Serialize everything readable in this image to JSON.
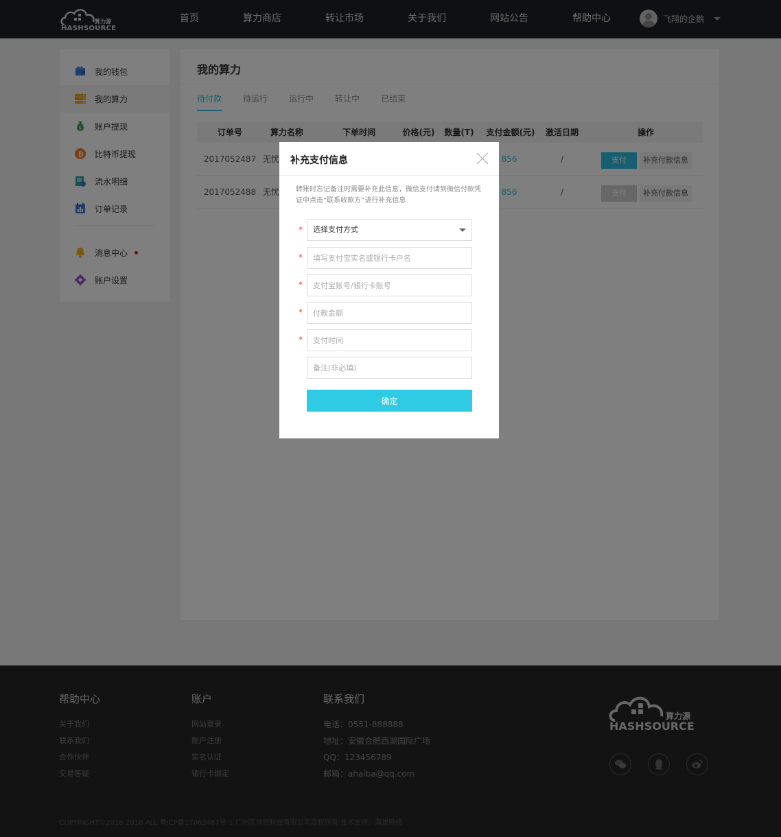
{
  "header": {
    "logo_cn": "算力源",
    "logo_en": "HASHSOURCE",
    "nav": [
      {
        "label": "首页"
      },
      {
        "label": "算力商店"
      },
      {
        "label": "转让市场"
      },
      {
        "label": "关于我们"
      },
      {
        "label": "网站公告"
      },
      {
        "label": "帮助中心"
      }
    ],
    "user_name": "飞翔的企鹅"
  },
  "sidebar": {
    "items": [
      {
        "label": "我的钱包",
        "icon": "wallet-icon",
        "color": "#3b7bd9"
      },
      {
        "label": "我的算力",
        "icon": "server-icon",
        "color": "#f0a21a"
      },
      {
        "label": "账户提现",
        "icon": "money-bag-icon",
        "color": "#3ba34a"
      },
      {
        "label": "比特币提现",
        "icon": "bitcoin-icon",
        "color": "#f07b27"
      },
      {
        "label": "流水明细",
        "icon": "ledger-icon",
        "color": "#26a69a"
      },
      {
        "label": "订单记录",
        "icon": "calendar-chart-icon",
        "color": "#3b7bd9"
      },
      {
        "label": "消息中心",
        "icon": "bell-icon",
        "color": "#f0b21a"
      },
      {
        "label": "账户设置",
        "icon": "gear-icon",
        "color": "#8e4fc9"
      }
    ]
  },
  "main": {
    "title": "我的算力",
    "tabs": [
      {
        "label": "待付款"
      },
      {
        "label": "待运行"
      },
      {
        "label": "运行中"
      },
      {
        "label": "转让中"
      },
      {
        "label": "已结束"
      }
    ],
    "columns": [
      "订单号",
      "算力名称",
      "下单时间",
      "价格(元)",
      "数量(T)",
      "支付金额(元)",
      "激活日期",
      "操作"
    ],
    "rows": [
      {
        "order_id": "2017052487",
        "name": "无忧",
        "amount": "856",
        "activation": "/",
        "pay_label": "支付",
        "info_label": "补充付款信息"
      },
      {
        "order_id": "2017052488",
        "name": "无忧",
        "amount": "856",
        "activation": "/",
        "pay_label": "支付",
        "info_label": "补充付款信息"
      }
    ]
  },
  "modal": {
    "title": "补充支付信息",
    "note": "转账时忘记备注时需要补充此信息，微信支付请到微信付款凭证中点击“联系收款方”进行补充信息",
    "select_label": "选择支付方式",
    "placeholders": {
      "account_name": "填写支付宝实名或银行卡户名",
      "account_no": "支付宝账号/银行卡账号",
      "amount": "付款金额",
      "time": "支付时间",
      "remark": "备注(非必填)"
    },
    "confirm_label": "确定",
    "required_mark": "*"
  },
  "footer": {
    "help": {
      "title": "帮助中心",
      "links": [
        "关于我们",
        "联系我们",
        "合作伙伴",
        "交易答疑"
      ]
    },
    "account": {
      "title": "账户",
      "links": [
        "网站登录",
        "账户注册",
        "实名认证",
        "银行卡绑定"
      ]
    },
    "contact": {
      "title": "联系我们",
      "lines": [
        "电话：0551-888888",
        "地址：安徽合肥西湖国际广场",
        "QQ：123456789",
        "邮箱：ahaiba@qq.com"
      ]
    },
    "copyright": "COPYRIGHT©2016-2018 ALL 粤ICP备17063467号-1 广州区块链科技有限公司版权所有  技术支持：海拔网络"
  },
  "colors": {
    "accent": "#2fbde0",
    "header_bg": "#1f2126",
    "footer_bg": "#262626",
    "required": "#e04545"
  }
}
